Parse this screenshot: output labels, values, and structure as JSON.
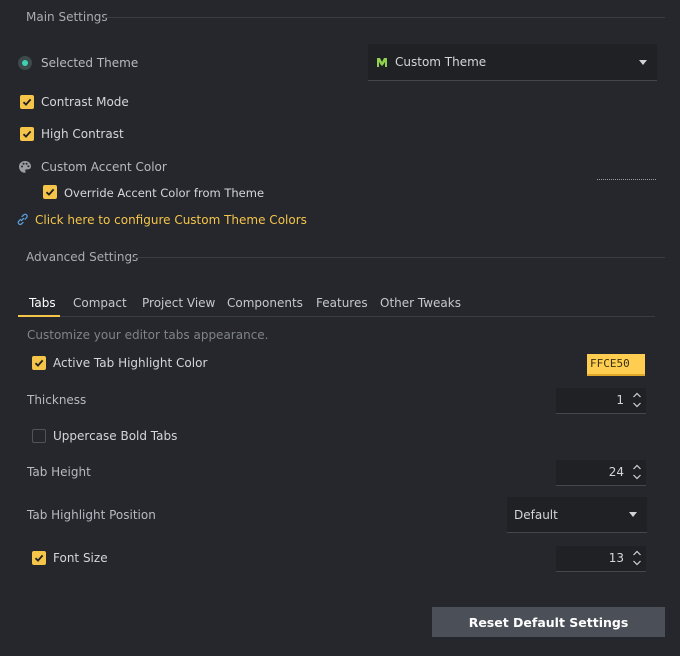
{
  "main_settings": {
    "title": "Main Settings",
    "selected_theme_label": "Selected Theme",
    "theme_value": "Custom Theme",
    "contrast_mode_label": "Contrast Mode",
    "contrast_mode_checked": true,
    "high_contrast_label": "High Contrast",
    "high_contrast_checked": true,
    "custom_accent_label": "Custom Accent Color",
    "override_accent_label": "Override Accent Color from Theme",
    "override_accent_checked": true,
    "configure_link": "Click here to configure Custom Theme Colors"
  },
  "advanced_settings": {
    "title": "Advanced Settings",
    "tabs": [
      "Tabs",
      "Compact",
      "Project View",
      "Components",
      "Features",
      "Other Tweaks"
    ],
    "active_tab": "Tabs",
    "description": "Customize your editor tabs appearance.",
    "active_tab_highlight_label": "Active Tab Highlight Color",
    "active_tab_highlight_checked": true,
    "highlight_color_value": "FFCE50",
    "thickness_label": "Thickness",
    "thickness_value": "1",
    "uppercase_bold_label": "Uppercase Bold Tabs",
    "uppercase_bold_checked": false,
    "tab_height_label": "Tab Height",
    "tab_height_value": "24",
    "highlight_position_label": "Tab Highlight Position",
    "highlight_position_value": "Default",
    "font_size_label": "Font Size",
    "font_size_checked": true,
    "font_size_value": "13"
  },
  "reset_button": "Reset Default Settings",
  "colors": {
    "accent": "#f5c54a",
    "background": "#25272c",
    "radio": "#3fd1b5",
    "highlight": "#ffce50"
  }
}
